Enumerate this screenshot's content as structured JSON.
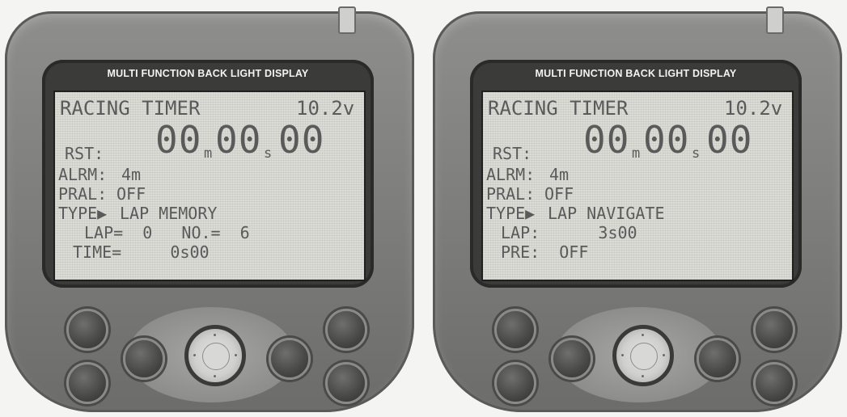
{
  "devices": [
    {
      "bezel_title": "MULTI  FUNCTION  BACK  LIGHT  DISPLAY",
      "lcd": {
        "title": "RACING TIMER",
        "voltage": "10.2v",
        "rst_label": "RST:",
        "rst_minutes": "00",
        "rst_min_unit": "m",
        "rst_seconds": "00",
        "rst_sec_unit": "s",
        "rst_hundredths": "00",
        "alrm_label": "ALRM:",
        "alrm_value": "4m",
        "pral_label": "PRAL:",
        "pral_value": "OFF",
        "type_label": "TYPE▶",
        "type_value": "LAP MEMORY",
        "line5": "LAP=  0   NO.=  6",
        "line6": "TIME=     0s00"
      }
    },
    {
      "bezel_title": "MULTI  FUNCTION  BACK  LIGHT  DISPLAY",
      "lcd": {
        "title": "RACING TIMER",
        "voltage": "10.2v",
        "rst_label": "RST:",
        "rst_minutes": "00",
        "rst_min_unit": "m",
        "rst_seconds": "00",
        "rst_sec_unit": "s",
        "rst_hundredths": "00",
        "alrm_label": "ALRM:",
        "alrm_value": "4m",
        "pral_label": "PRAL:",
        "pral_value": "OFF",
        "type_label": "TYPE▶",
        "type_value": "LAP NAVIGATE",
        "line5": "LAP:      3s00",
        "line6": "PRE:  OFF"
      }
    }
  ]
}
